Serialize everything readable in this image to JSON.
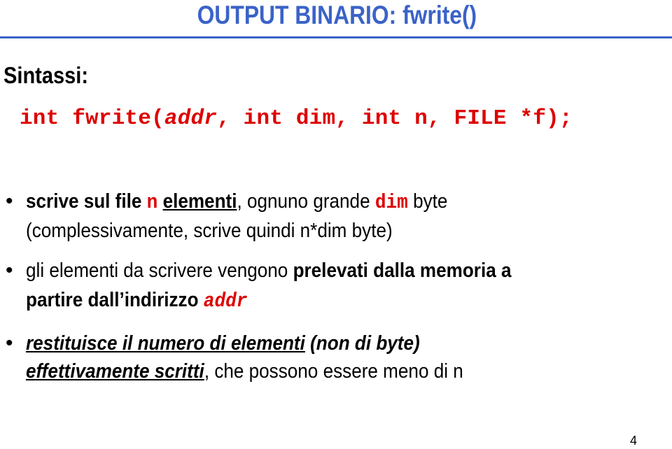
{
  "slide": {
    "title": "OUTPUT BINARIO: fwrite()",
    "syntax_label": "Sintassi:",
    "prototype": {
      "part1": "int fwrite(",
      "param_addr": "addr",
      "part2": ", int dim, int n, FILE *f);"
    },
    "bullets": [
      {
        "line1": {
          "bold": "scrive sul file ",
          "code_n": "n",
          "space": " ",
          "bold_underlined": "elementi",
          "text": ", ognuno grande ",
          "code_dim": "dim",
          "text2": " byte"
        },
        "line2": "(complessivamente, scrive quindi n*dim byte)"
      },
      {
        "line1": {
          "text": "gli elementi da scrivere vengono ",
          "bold": "prelevati dalla memoria a"
        },
        "line2": {
          "bold": "partire dall’indirizzo ",
          "code_addr": "addr"
        }
      },
      {
        "line1": {
          "bold_italic_underlined": "restituisce il numero di elementi",
          "bold_italic": " (non di byte)"
        },
        "line2": {
          "bold_italic_underlined": "effettivamente scritti",
          "text": ", che possono essere meno di n"
        }
      }
    ],
    "bullet_symbol": "•",
    "page_number": "4",
    "colors": {
      "title": "#3a63c8",
      "code": "#dd0000"
    }
  }
}
